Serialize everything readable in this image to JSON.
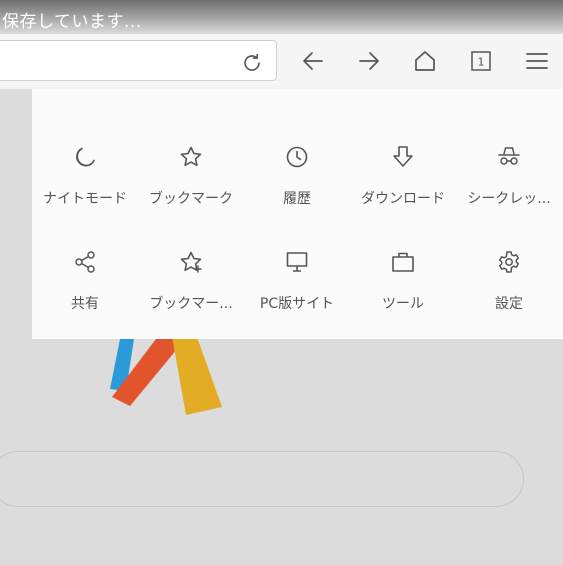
{
  "status_bar": {
    "text": "保存しています..."
  },
  "toolbar": {
    "url_value": "",
    "tab_count": "1",
    "icons": [
      "reload-icon",
      "back-arrow-icon",
      "forward-arrow-icon",
      "home-icon",
      "tab-count-icon",
      "menu-icon"
    ]
  },
  "menu": {
    "items": [
      {
        "label": "ナイトモード",
        "icon": "moon-icon"
      },
      {
        "label": "ブックマーク",
        "icon": "star-icon"
      },
      {
        "label": "履歴",
        "icon": "clock-icon"
      },
      {
        "label": "ダウンロード",
        "icon": "download-arrow-icon"
      },
      {
        "label": "シークレッ...",
        "icon": "incognito-icon"
      },
      {
        "label": "共有",
        "icon": "share-icon"
      },
      {
        "label": "ブックマー...",
        "icon": "star-plus-icon"
      },
      {
        "label": "PC版サイト",
        "icon": "monitor-icon"
      },
      {
        "label": "ツール",
        "icon": "briefcase-icon"
      },
      {
        "label": "設定",
        "icon": "gear-icon"
      }
    ]
  },
  "colors": {
    "logo_blue": "#2a9ad9",
    "logo_red": "#e2542b",
    "logo_yellow": "#e2ad24",
    "icon_gray": "#555555"
  }
}
